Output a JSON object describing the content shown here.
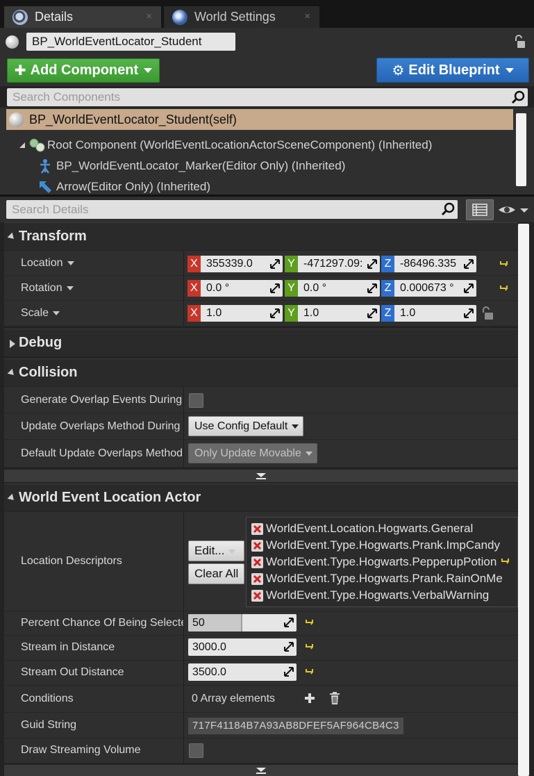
{
  "tabs": [
    {
      "label": "Details",
      "icon": "details-icon",
      "active": true
    },
    {
      "label": "World Settings",
      "icon": "globe-icon",
      "active": false
    }
  ],
  "actor_name": "BP_WorldEventLocator_Student",
  "toolbar": {
    "add_component": "Add Component",
    "edit_blueprint": "Edit Blueprint"
  },
  "components_search": {
    "placeholder": "Search Components"
  },
  "tree": {
    "self": "BP_WorldEventLocator_Student(self)",
    "root": "Root Component (WorldEventLocationActorSceneComponent) (Inherited)",
    "marker": "BP_WorldEventLocator_Marker(Editor Only) (Inherited)",
    "arrow": "Arrow(Editor Only) (Inherited)"
  },
  "details_search": {
    "placeholder": "Search Details"
  },
  "transform": {
    "title": "Transform",
    "location": {
      "label": "Location",
      "x": "355339.0",
      "y": "-471297.09:",
      "z": "-86496.335"
    },
    "rotation": {
      "label": "Rotation",
      "x": "0.0 °",
      "y": "0.0 °",
      "z": "0.000673 °"
    },
    "scale": {
      "label": "Scale",
      "x": "1.0",
      "y": "1.0",
      "z": "1.0"
    }
  },
  "axes": {
    "x": "X",
    "y": "Y",
    "z": "Z"
  },
  "debug": {
    "title": "Debug"
  },
  "collision": {
    "title": "Collision",
    "generate_overlap": {
      "label": "Generate Overlap Events During l",
      "checked": false
    },
    "update_overlaps": {
      "label": "Update Overlaps Method During",
      "value": "Use Config Default"
    },
    "default_update": {
      "label": "Default Update Overlaps Method",
      "value": "Only Update Movable"
    }
  },
  "world_event": {
    "title": "World Event Location Actor",
    "location_descriptors": {
      "label": "Location Descriptors",
      "edit_button": "Edit...",
      "clear_button": "Clear All",
      "tags": [
        "WorldEvent.Location.Hogwarts.General",
        "WorldEvent.Type.Hogwarts.Prank.ImpCandy",
        "WorldEvent.Type.Hogwarts.PepperupPotion",
        "WorldEvent.Type.Hogwarts.Prank.RainOnMe",
        "WorldEvent.Type.Hogwarts.VerbalWarning"
      ]
    },
    "percent_chance": {
      "label": "Percent Chance Of Being Selectec",
      "value": "50",
      "fraction": 0.5
    },
    "stream_in": {
      "label": "Stream in Distance",
      "value": "3000.0"
    },
    "stream_out": {
      "label": "Stream Out Distance",
      "value": "3500.0"
    },
    "conditions": {
      "label": "Conditions",
      "value": "0 Array elements"
    },
    "guid": {
      "label": "Guid String",
      "value": "717F41184B7A93AB8DFEF5AF964CB4C3"
    },
    "draw_streaming": {
      "label": "Draw Streaming Volume",
      "checked": false
    }
  },
  "colors": {
    "add_green": "#4aa83f",
    "edit_blue": "#2e72c4",
    "self_row": "#c7a98b",
    "axis_x": "#c6372a",
    "axis_y": "#5e9d1e",
    "axis_z": "#2e6fcf"
  }
}
